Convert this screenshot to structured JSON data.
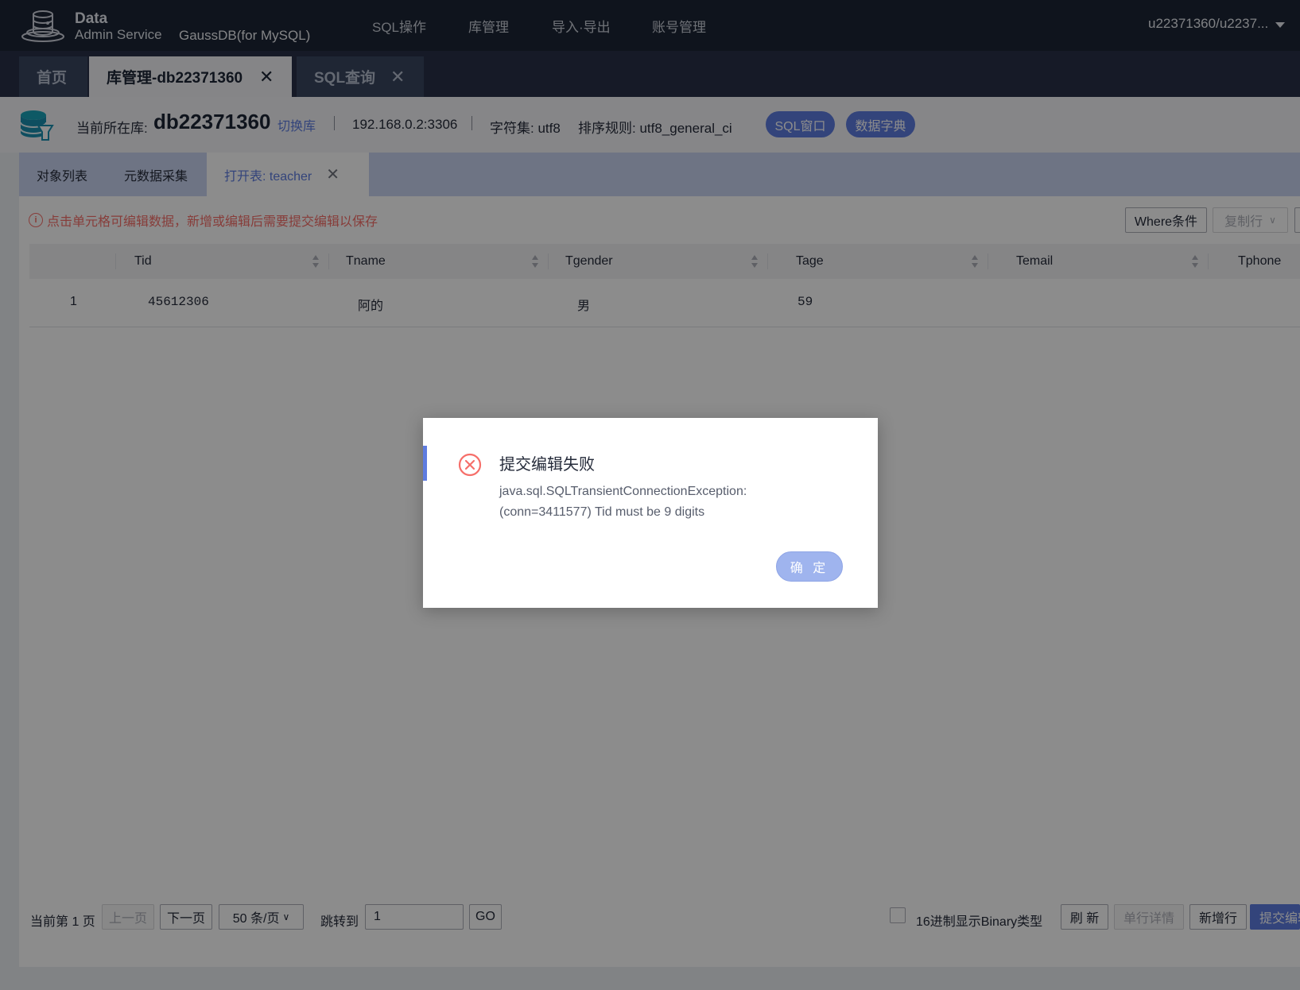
{
  "header": {
    "logo_line1": "Data",
    "logo_line2": "Admin Service",
    "product": "GaussDB(for MySQL)",
    "nav": [
      "SQL操作",
      "库管理",
      "导入·导出",
      "账号管理"
    ],
    "user": "u22371360/u2237..."
  },
  "page_tabs": [
    {
      "label": "首页",
      "closable": false,
      "active": false
    },
    {
      "label": "库管理-db22371360",
      "closable": true,
      "active": true
    },
    {
      "label": "SQL查询",
      "closable": true,
      "active": false
    }
  ],
  "db_info": {
    "current_db_label": "当前所在库:",
    "db_name": "db22371360",
    "switch_label": "切换库",
    "host": "192.168.0.2:3306",
    "charset": "字符集: utf8",
    "collation": "排序规则: utf8_general_ci",
    "sql_window_btn": "SQL窗口",
    "data_dict_btn": "数据字典"
  },
  "sub_tabs": [
    {
      "label": "对象列表"
    },
    {
      "label": "元数据采集"
    },
    {
      "label": "打开表: teacher",
      "active": true
    }
  ],
  "toolbar": {
    "notice": "点击单元格可编辑数据，新增或编辑后需要提交编辑以保存",
    "where_btn": "Where条件",
    "copy_row_btn": "复制行"
  },
  "table": {
    "columns": [
      "Tid",
      "Tname",
      "Tgender",
      "Tage",
      "Temail",
      "Tphone"
    ],
    "rows": [
      {
        "index": "1",
        "Tid": "45612306",
        "Tname": "阿的",
        "Tgender": "男",
        "Tage": "59",
        "Temail": "",
        "Tphone": ""
      }
    ]
  },
  "pager": {
    "current_page": "当前第 1 页",
    "prev": "上一页",
    "next": "下一页",
    "page_size": "50 条/页",
    "jump_label": "跳转到",
    "jump_value": "1",
    "go": "GO",
    "hex_checkbox": "16进制显示Binary类型",
    "refresh": "刷 新",
    "row_detail": "单行详情",
    "add_row": "新增行",
    "submit_edit": "提交编辑"
  },
  "dialog": {
    "title": "提交编辑失败",
    "message_line1": "java.sql.SQLTransientConnectionException:",
    "message_line2": "(conn=3411577) Tid must be 9 digits",
    "ok": "确 定"
  },
  "colors": {
    "nav_bg": "#1d2535",
    "accent": "#5e7ce0",
    "error": "#f66f6a"
  }
}
